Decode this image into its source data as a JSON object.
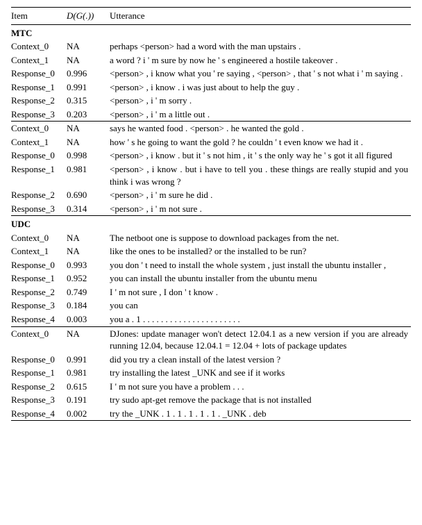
{
  "columns": {
    "item": "Item",
    "score": "D(G(.))",
    "utterance": "Utterance"
  },
  "sections": [
    {
      "name": "MTC",
      "blocks": [
        {
          "rows": [
            {
              "item": "Context_0",
              "score": "NA",
              "utt": "perhaps <person> had a word with the man upstairs ."
            },
            {
              "item": "Context_1",
              "score": "NA",
              "utt": "a word ? i ' m sure by now he ' s engineered a hostile takeover ."
            },
            {
              "item": "Response_0",
              "score": "0.996",
              "utt": "<person> , i know what you ' re saying , <person> , that ' s not what i ' m saying ."
            },
            {
              "item": "Response_1",
              "score": "0.991",
              "utt": "<person> , i know . i was just about to help the guy ."
            },
            {
              "item": "Response_2",
              "score": "0.315",
              "utt": "<person> , i ' m sorry ."
            },
            {
              "item": "Response_3",
              "score": "0.203",
              "utt": "<person> , i ' m a little out ."
            }
          ]
        },
        {
          "rows": [
            {
              "item": "Context_0",
              "score": "NA",
              "utt": "says he wanted food . <person> . he wanted the gold ."
            },
            {
              "item": "Context_1",
              "score": "NA",
              "utt": "how ' s he going to want the gold ? he couldn ' t even know we had it ."
            },
            {
              "item": "Response_0",
              "score": "0.998",
              "utt": "<person> , i know . but it ' s not him , it ' s the only way he ' s got it all figured"
            },
            {
              "item": "Response_1",
              "score": "0.981",
              "utt": "<person> , i know . but i have to tell you . these things are really stupid and you think i was wrong ?"
            },
            {
              "item": "Response_2",
              "score": "0.690",
              "utt": "<person> , i ' m sure he did ."
            },
            {
              "item": "Response_3",
              "score": "0.314",
              "utt": "<person> , i ' m not sure ."
            }
          ]
        }
      ]
    },
    {
      "name": "UDC",
      "blocks": [
        {
          "rows": [
            {
              "item": "Context_0",
              "score": "NA",
              "utt": "The netboot one is suppose to download packages from the net."
            },
            {
              "item": "Context_1",
              "score": "NA",
              "utt": "like the ones to be installed? or the installed to be run?"
            },
            {
              "item": "Response_0",
              "score": "0.993",
              "utt": "you don ' t need to install the whole system , just install the ubuntu installer ,"
            },
            {
              "item": "Response_1",
              "score": "0.952",
              "utt": "you can install the ubuntu installer from the ubuntu menu"
            },
            {
              "item": "Response_2",
              "score": "0.749",
              "utt": "I ' m not sure , I don ' t know ."
            },
            {
              "item": "Response_3",
              "score": "0.184",
              "utt": "you can"
            },
            {
              "item": "Response_4",
              "score": "0.003",
              "utt": "you a . 1 . . . . . . . . . . . . . . . . . . . . . ."
            }
          ]
        },
        {
          "rows": [
            {
              "item": "Context_0",
              "score": "NA",
              "utt": "DJones: update manager won't detect 12.04.1 as a new version if you are already running 12.04, because 12.04.1 = 12.04 + lots of package updates"
            },
            {
              "item": "Response_0",
              "score": "0.991",
              "utt": "did you try a clean install of the latest version ?"
            },
            {
              "item": "Response_1",
              "score": "0.981",
              "utt": "try installing the latest _UNK and see if it works"
            },
            {
              "item": "Response_2",
              "score": "0.615",
              "utt": "I ' m not sure you have a problem . . ."
            },
            {
              "item": "Response_3",
              "score": "0.191",
              "utt": "try sudo apt-get remove the package that is not installed"
            },
            {
              "item": "Response_4",
              "score": "0.002",
              "utt": "try the _UNK . 1 . 1 . 1 . 1 . 1 . _UNK . deb"
            }
          ]
        }
      ]
    }
  ]
}
